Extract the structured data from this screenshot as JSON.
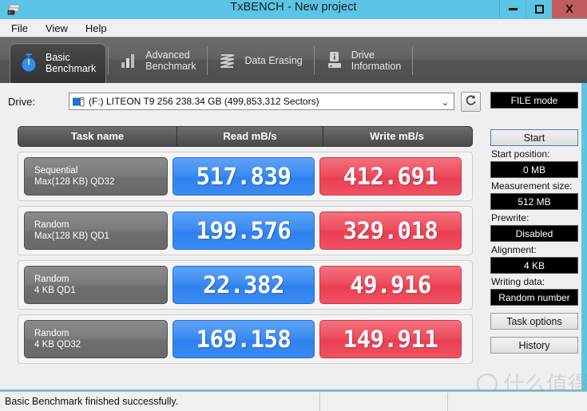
{
  "window": {
    "title": "TxBENCH - New project",
    "app_icon": "drive-stack-icon",
    "minimize_label": "Minimize",
    "maximize_label": "Maximize",
    "close_label": "X",
    "titlebar_color": "#5cc4e4",
    "close_color": "#c35c5c"
  },
  "menubar": {
    "items": [
      {
        "label": "File"
      },
      {
        "label": "View"
      },
      {
        "label": "Help"
      }
    ]
  },
  "tabs": [
    {
      "label": "Basic\nBenchmark",
      "icon": "stopwatch-icon",
      "active": true
    },
    {
      "label": "Advanced\nBenchmark",
      "icon": "bar-chart-icon",
      "active": false
    },
    {
      "label": "Data Erasing",
      "icon": "shred-zigzag-icon",
      "active": false
    },
    {
      "label": "Drive\nInformation",
      "icon": "drive-info-icon",
      "active": false
    }
  ],
  "drive": {
    "label": "Drive:",
    "value": "(F:) LITEON T9  256  238.34 GB (499,853,312 Sectors)",
    "caret": "⌄",
    "device_icon": "hard-disk-icon",
    "refresh_icon": "refresh-icon"
  },
  "results": {
    "headers": [
      "Task name",
      "Read mB/s",
      "Write mB/s"
    ],
    "rows": [
      {
        "task_line1": "Sequential",
        "task_line2": "Max(128 KB) QD32",
        "read": "517.839",
        "write": "412.691"
      },
      {
        "task_line1": "Random",
        "task_line2": "Max(128 KB) QD1",
        "read": "199.576",
        "write": "329.018"
      },
      {
        "task_line1": "Random",
        "task_line2": "4 KB QD1",
        "read": "22.382",
        "write": "49.916"
      },
      {
        "task_line1": "Random",
        "task_line2": "4 KB QD32",
        "read": "169.158",
        "write": "149.911"
      }
    ],
    "read_color": "#3a8bf3",
    "write_color": "#ee4d5e"
  },
  "sidebar": {
    "mode": "FILE mode",
    "start_button": "Start",
    "start_position_caption": "Start position:",
    "start_position_value": "0 MB",
    "measurement_size_caption": "Measurement size:",
    "measurement_size_value": "512 MB",
    "prewrite_caption": "Prewrite:",
    "prewrite_value": "Disabled",
    "alignment_caption": "Alignment:",
    "alignment_value": "4 KB",
    "writing_data_caption": "Writing data:",
    "writing_data_value": "Random number",
    "task_options_button": "Task options",
    "history_button": "History"
  },
  "statusbar": {
    "message": "Basic Benchmark finished successfully.",
    "pane2": "",
    "pane3": ""
  },
  "watermark": {
    "text": "什么值得买"
  }
}
